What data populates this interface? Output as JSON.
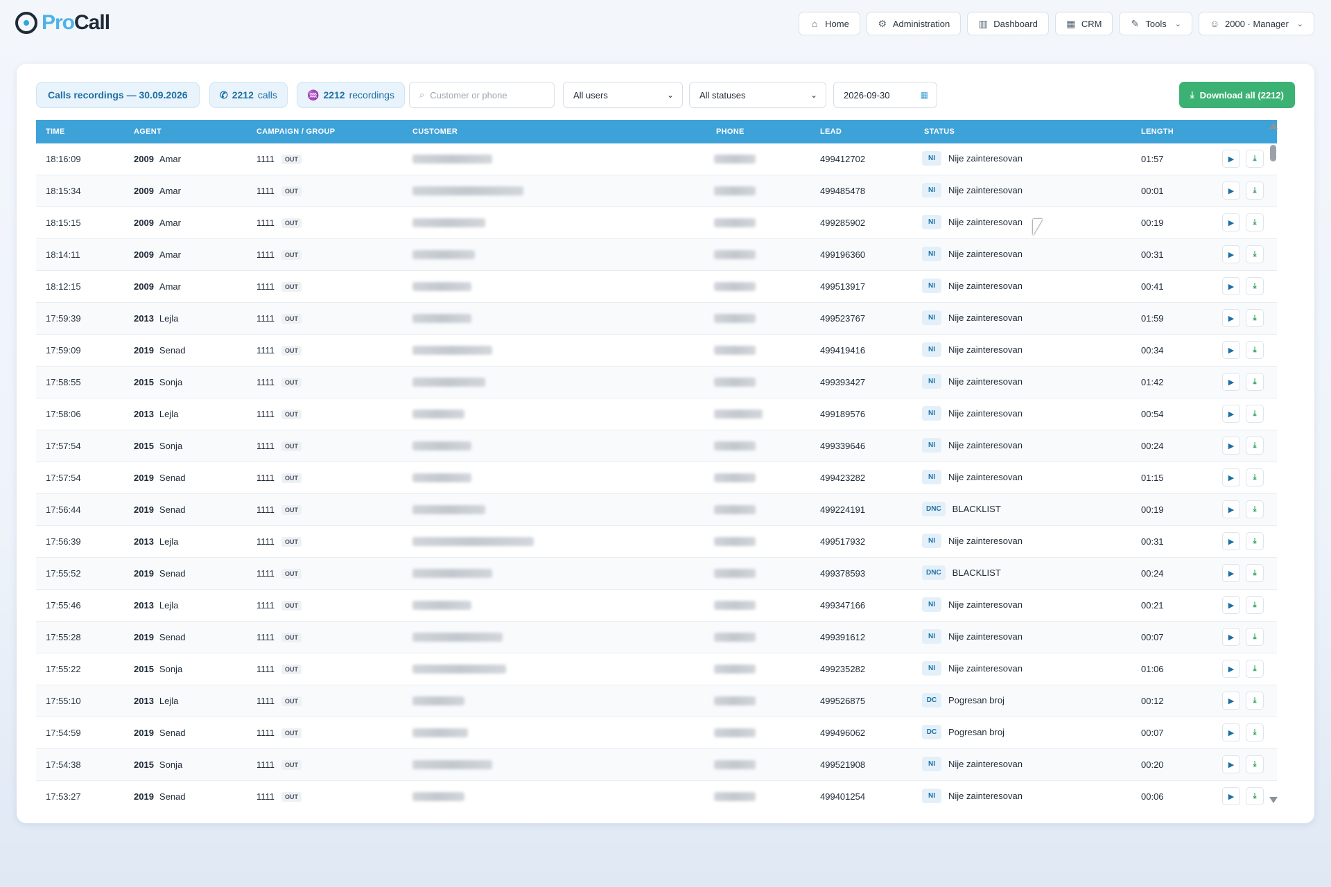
{
  "app": {
    "logo_pro": "Pro",
    "logo_call": "Call"
  },
  "nav": [
    {
      "label": "Home",
      "icon": "home-icon",
      "glyph": "⌂"
    },
    {
      "label": "Administration",
      "icon": "gear-icon",
      "glyph": "⚙"
    },
    {
      "label": "Dashboard",
      "icon": "bar-chart-icon",
      "glyph": "▥"
    },
    {
      "label": "CRM",
      "icon": "building-icon",
      "glyph": "▦"
    },
    {
      "label": "Tools",
      "icon": "wrench-icon",
      "glyph": "✎",
      "dropdown": true
    },
    {
      "label": "2000 · Manager",
      "icon": "user-icon",
      "glyph": "☺",
      "dropdown": true
    }
  ],
  "toolbar": {
    "title": "Calls recordings — 30.09.2026",
    "calls_count": "2212",
    "calls_label": "calls",
    "recordings_count": "2212",
    "recordings_label": "recordings",
    "search_placeholder": "Customer or phone",
    "users_select": "All users",
    "status_select": "All statuses",
    "date_value": "2026-09-30",
    "download_label": "Download all (2212)"
  },
  "columns": {
    "time": "TIME",
    "agent": "AGENT",
    "campaign": "CAMPAIGN / GROUP",
    "customer": "CUSTOMER",
    "phone": "PHONE",
    "lead": "LEAD",
    "status": "STATUS",
    "length": "LENGTH"
  },
  "rows": [
    {
      "time": "18:16:09",
      "agent_id": "2009",
      "agent": "Amar",
      "campaign": "1111",
      "dir": "OUT",
      "lead": "499412702",
      "code": "NI",
      "status": "Nije zainteresovan",
      "length": "01:57"
    },
    {
      "time": "18:15:34",
      "agent_id": "2009",
      "agent": "Amar",
      "campaign": "1111",
      "dir": "OUT",
      "lead": "499485478",
      "code": "NI",
      "status": "Nije zainteresovan",
      "length": "00:01"
    },
    {
      "time": "18:15:15",
      "agent_id": "2009",
      "agent": "Amar",
      "campaign": "1111",
      "dir": "OUT",
      "lead": "499285902",
      "code": "NI",
      "status": "Nije zainteresovan",
      "length": "00:19"
    },
    {
      "time": "18:14:11",
      "agent_id": "2009",
      "agent": "Amar",
      "campaign": "1111",
      "dir": "OUT",
      "lead": "499196360",
      "code": "NI",
      "status": "Nije zainteresovan",
      "length": "00:31"
    },
    {
      "time": "18:12:15",
      "agent_id": "2009",
      "agent": "Amar",
      "campaign": "1111",
      "dir": "OUT",
      "lead": "499513917",
      "code": "NI",
      "status": "Nije zainteresovan",
      "length": "00:41"
    },
    {
      "time": "17:59:39",
      "agent_id": "2013",
      "agent": "Lejla",
      "campaign": "1111",
      "dir": "OUT",
      "lead": "499523767",
      "code": "NI",
      "status": "Nije zainteresovan",
      "length": "01:59"
    },
    {
      "time": "17:59:09",
      "agent_id": "2019",
      "agent": "Senad",
      "campaign": "1111",
      "dir": "OUT",
      "lead": "499419416",
      "code": "NI",
      "status": "Nije zainteresovan",
      "length": "00:34"
    },
    {
      "time": "17:58:55",
      "agent_id": "2015",
      "agent": "Sonja",
      "campaign": "1111",
      "dir": "OUT",
      "lead": "499393427",
      "code": "NI",
      "status": "Nije zainteresovan",
      "length": "01:42"
    },
    {
      "time": "17:58:06",
      "agent_id": "2013",
      "agent": "Lejla",
      "campaign": "1111",
      "dir": "OUT",
      "lead": "499189576",
      "code": "NI",
      "status": "Nije zainteresovan",
      "length": "00:54"
    },
    {
      "time": "17:57:54",
      "agent_id": "2015",
      "agent": "Sonja",
      "campaign": "1111",
      "dir": "OUT",
      "lead": "499339646",
      "code": "NI",
      "status": "Nije zainteresovan",
      "length": "00:24"
    },
    {
      "time": "17:57:54",
      "agent_id": "2019",
      "agent": "Senad",
      "campaign": "1111",
      "dir": "OUT",
      "lead": "499423282",
      "code": "NI",
      "status": "Nije zainteresovan",
      "length": "01:15"
    },
    {
      "time": "17:56:44",
      "agent_id": "2019",
      "agent": "Senad",
      "campaign": "1111",
      "dir": "OUT",
      "lead": "499224191",
      "code": "DNC",
      "status": "BLACKLIST",
      "length": "00:19"
    },
    {
      "time": "17:56:39",
      "agent_id": "2013",
      "agent": "Lejla",
      "campaign": "1111",
      "dir": "OUT",
      "lead": "499517932",
      "code": "NI",
      "status": "Nije zainteresovan",
      "length": "00:31"
    },
    {
      "time": "17:55:52",
      "agent_id": "2019",
      "agent": "Senad",
      "campaign": "1111",
      "dir": "OUT",
      "lead": "499378593",
      "code": "DNC",
      "status": "BLACKLIST",
      "length": "00:24"
    },
    {
      "time": "17:55:46",
      "agent_id": "2013",
      "agent": "Lejla",
      "campaign": "1111",
      "dir": "OUT",
      "lead": "499347166",
      "code": "NI",
      "status": "Nije zainteresovan",
      "length": "00:21"
    },
    {
      "time": "17:55:28",
      "agent_id": "2019",
      "agent": "Senad",
      "campaign": "1111",
      "dir": "OUT",
      "lead": "499391612",
      "code": "NI",
      "status": "Nije zainteresovan",
      "length": "00:07"
    },
    {
      "time": "17:55:22",
      "agent_id": "2015",
      "agent": "Sonja",
      "campaign": "1111",
      "dir": "OUT",
      "lead": "499235282",
      "code": "NI",
      "status": "Nije zainteresovan",
      "length": "01:06"
    },
    {
      "time": "17:55:10",
      "agent_id": "2013",
      "agent": "Lejla",
      "campaign": "1111",
      "dir": "OUT",
      "lead": "499526875",
      "code": "DC",
      "status": "Pogresan broj",
      "length": "00:12"
    },
    {
      "time": "17:54:59",
      "agent_id": "2019",
      "agent": "Senad",
      "campaign": "1111",
      "dir": "OUT",
      "lead": "499496062",
      "code": "DC",
      "status": "Pogresan broj",
      "length": "00:07"
    },
    {
      "time": "17:54:38",
      "agent_id": "2015",
      "agent": "Sonja",
      "campaign": "1111",
      "dir": "OUT",
      "lead": "499521908",
      "code": "NI",
      "status": "Nije zainteresovan",
      "length": "00:20"
    },
    {
      "time": "17:53:27",
      "agent_id": "2019",
      "agent": "Senad",
      "campaign": "1111",
      "dir": "OUT",
      "lead": "499401254",
      "code": "NI",
      "status": "Nije zainteresovan",
      "length": "00:06"
    }
  ]
}
